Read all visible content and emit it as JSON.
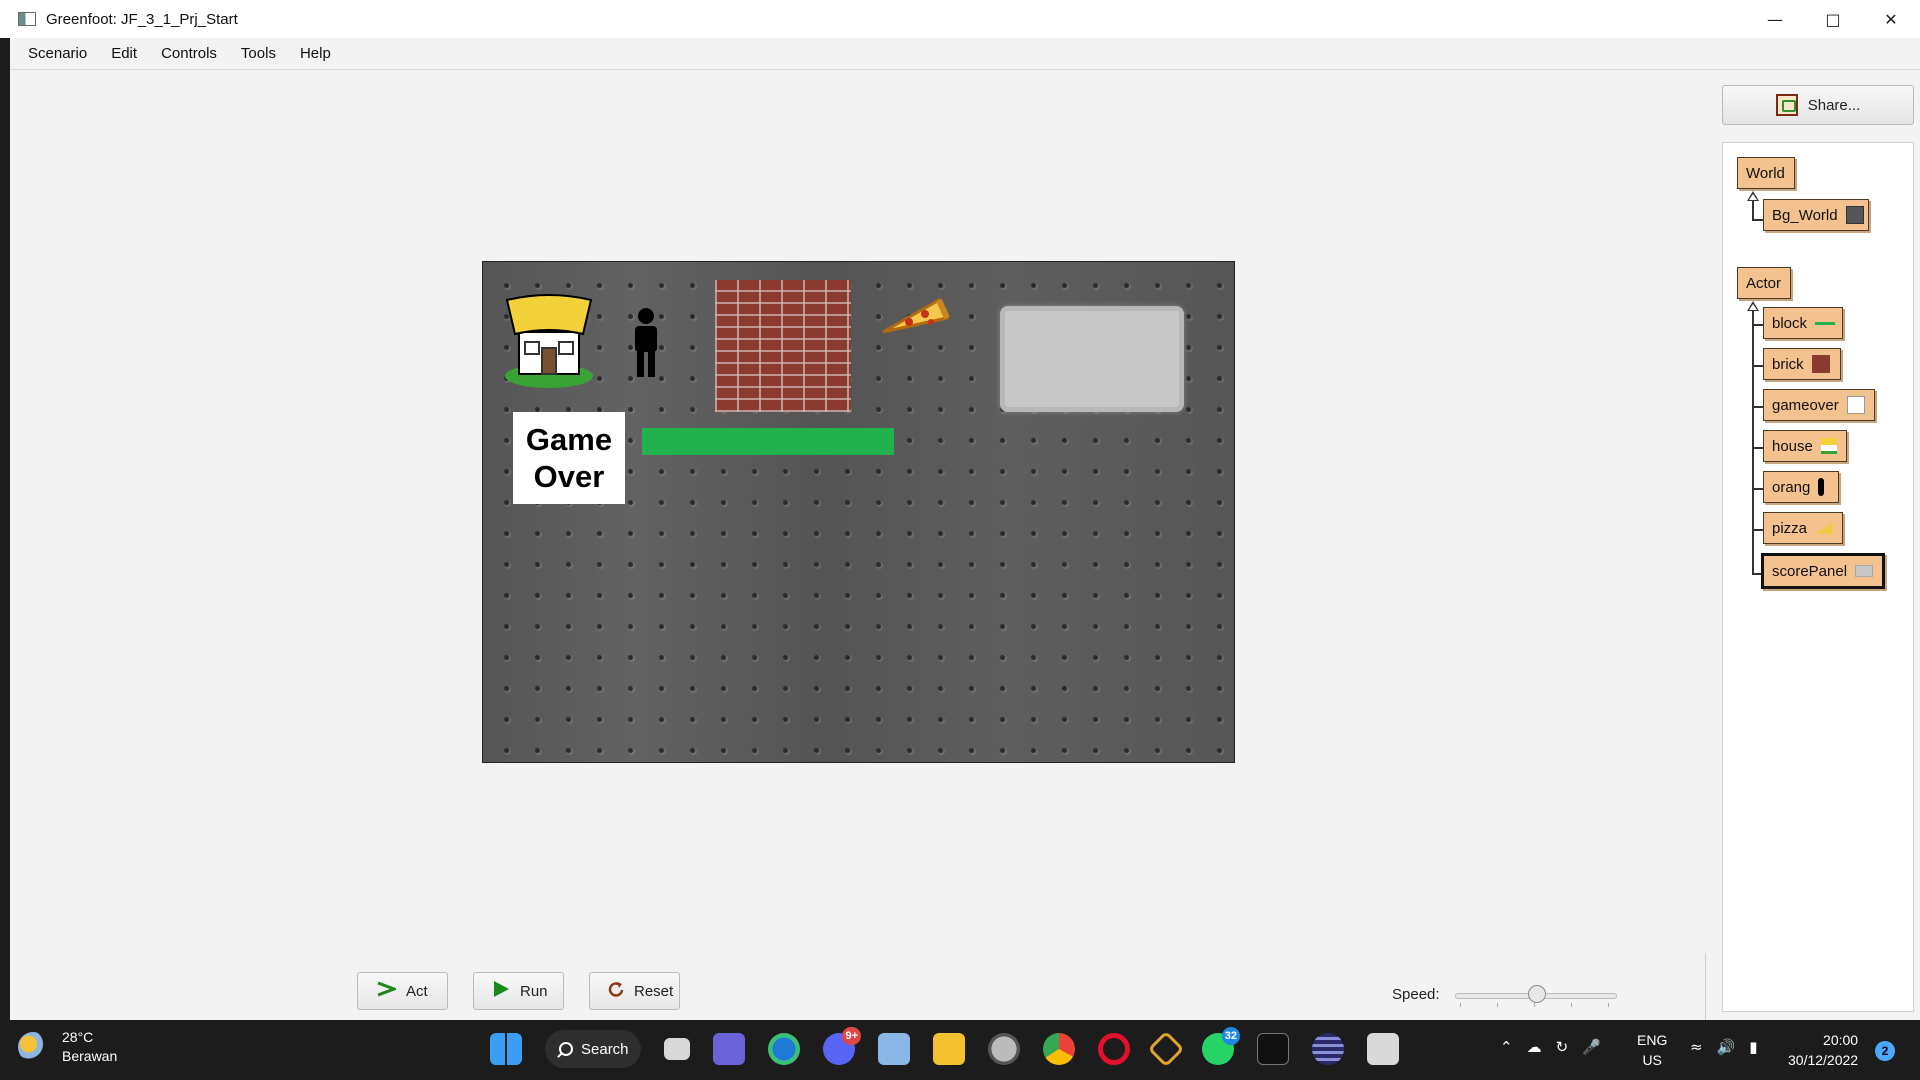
{
  "window": {
    "title": "Greenfoot: JF_3_1_Prj_Start"
  },
  "menu": [
    "Scenario",
    "Edit",
    "Controls",
    "Tools",
    "Help"
  ],
  "world": {
    "gameover_line1": "Game",
    "gameover_line2": "Over"
  },
  "controls": {
    "act": "Act",
    "run": "Run",
    "reset": "Reset",
    "speed_label": "Speed:",
    "speed_value": 0.45
  },
  "share": {
    "label": "Share..."
  },
  "classes": {
    "world_root": "World",
    "world_sub": "Bg_World",
    "actor_root": "Actor",
    "actors": [
      "block",
      "brick",
      "gameover",
      "house",
      "orang",
      "pizza",
      "scorePanel"
    ],
    "selected": "scorePanel"
  },
  "taskbar": {
    "temp": "28°C",
    "condition": "Berawan",
    "search": "Search",
    "discord_badge": "9+",
    "whatsapp_badge": "32",
    "lang1": "ENG",
    "lang2": "US",
    "time": "20:00",
    "date": "30/12/2022",
    "notifications": "2"
  },
  "colors": {
    "class_fill": "#f4c28f",
    "block_green": "#22b14c",
    "panel_gray": "#c8c8c8"
  }
}
